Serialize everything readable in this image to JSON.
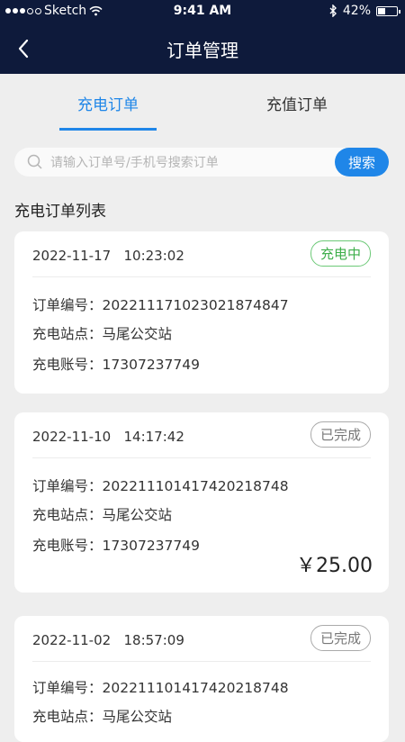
{
  "status_bar": {
    "carrier": "Sketch",
    "time": "9:41 AM",
    "battery_text": "42%",
    "battery_level": 0.42
  },
  "header": {
    "title": "订单管理"
  },
  "tabs": [
    {
      "label": "充电订单",
      "active": true
    },
    {
      "label": "充值订单",
      "active": false
    }
  ],
  "search": {
    "placeholder": "请输入订单号/手机号搜索订单",
    "button_label": "搜索"
  },
  "list_title": "充电订单列表",
  "labels": {
    "order_no": "订单编号：",
    "station": "充电站点：",
    "account": "充电账号："
  },
  "orders": [
    {
      "date": "2022-11-17",
      "time": "10:23:02",
      "status": "充电中",
      "order_no": "202211171023021874847",
      "station": "马尾公交站",
      "account": "17307237749",
      "amount": ""
    },
    {
      "date": "2022-11-10",
      "time": "14:17:42",
      "status": "已完成",
      "order_no": "202211101417420218748",
      "station": "马尾公交站",
      "account": "17307237749",
      "amount": "￥25.00"
    },
    {
      "date": "2022-11-02",
      "time": "18:57:09",
      "status": "已完成",
      "order_no": "202211101417420218748",
      "station": "马尾公交站",
      "account": "",
      "amount": ""
    }
  ],
  "colors": {
    "nav_bg": "#0e1a3b",
    "accent": "#1f86e8",
    "charging": "#3dae4a",
    "page_bg": "#eeeeee"
  }
}
